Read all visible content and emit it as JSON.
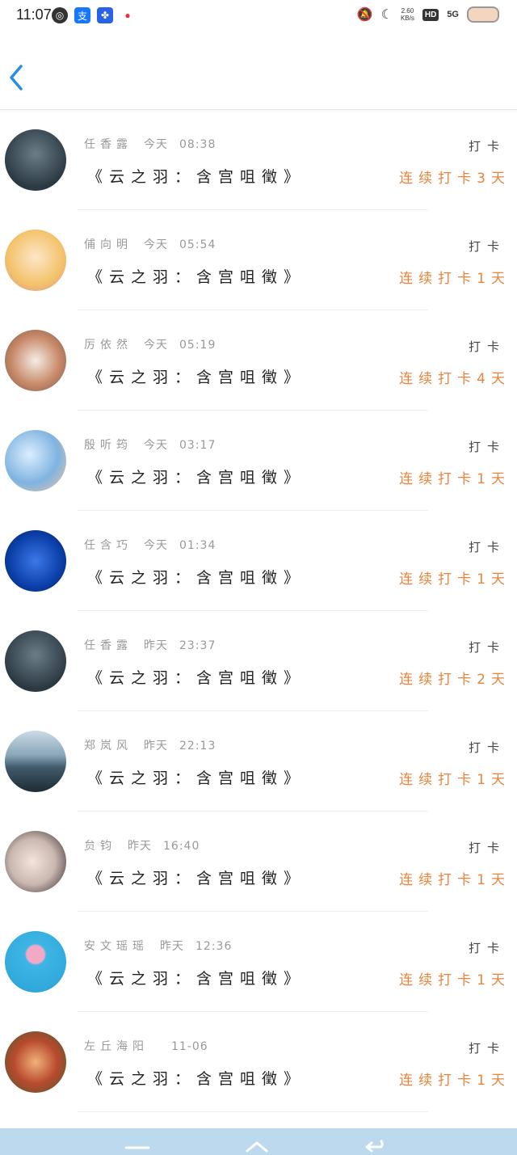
{
  "status_bar": {
    "time": "11:07",
    "net_speed_top": "2.60",
    "net_speed_bottom": "KB/s",
    "hd": "HD",
    "signal": "5G"
  },
  "header": {
    "back_icon": "chevron-left-icon"
  },
  "checkin_label": "打卡",
  "title": "《云之羽：含宫咀徵》",
  "items": [
    {
      "name": "任香露",
      "date": "今天",
      "time": "08:38",
      "streak": "连续打卡3天",
      "avatar_color": "#2b3942"
    },
    {
      "name": "俌向明",
      "date": "今天",
      "time": "05:54",
      "streak": "连续打卡1天",
      "avatar_color": "#f3c36a"
    },
    {
      "name": "厉依然",
      "date": "今天",
      "time": "05:19",
      "streak": "连续打卡4天",
      "avatar_color": "#c98a6a"
    },
    {
      "name": "殷听筠",
      "date": "今天",
      "time": "03:17",
      "streak": "连续打卡1天",
      "avatar_color": "#7fb3e0"
    },
    {
      "name": "任含巧",
      "date": "今天",
      "time": "01:34",
      "streak": "连续打卡1天",
      "avatar_color": "#0b3fa8"
    },
    {
      "name": "任香露",
      "date": "昨天",
      "time": "23:37",
      "streak": "连续打卡2天",
      "avatar_color": "#2b3942"
    },
    {
      "name": "郑岚风",
      "date": "昨天",
      "time": "22:13",
      "streak": "连续打卡1天",
      "avatar_color": "#405a6a"
    },
    {
      "name": "贠钧",
      "date": "昨天",
      "time": "16:40",
      "streak": "连续打卡1天",
      "avatar_color": "#c9b7b0"
    },
    {
      "name": "安文瑶瑶",
      "date": "昨天",
      "time": "12:36",
      "streak": "连续打卡1天",
      "avatar_color": "#3db6e6"
    },
    {
      "name": "左丘海阳",
      "date": "",
      "time": "11-06",
      "streak": "连续打卡1天",
      "avatar_color": "#b84a2e"
    }
  ]
}
